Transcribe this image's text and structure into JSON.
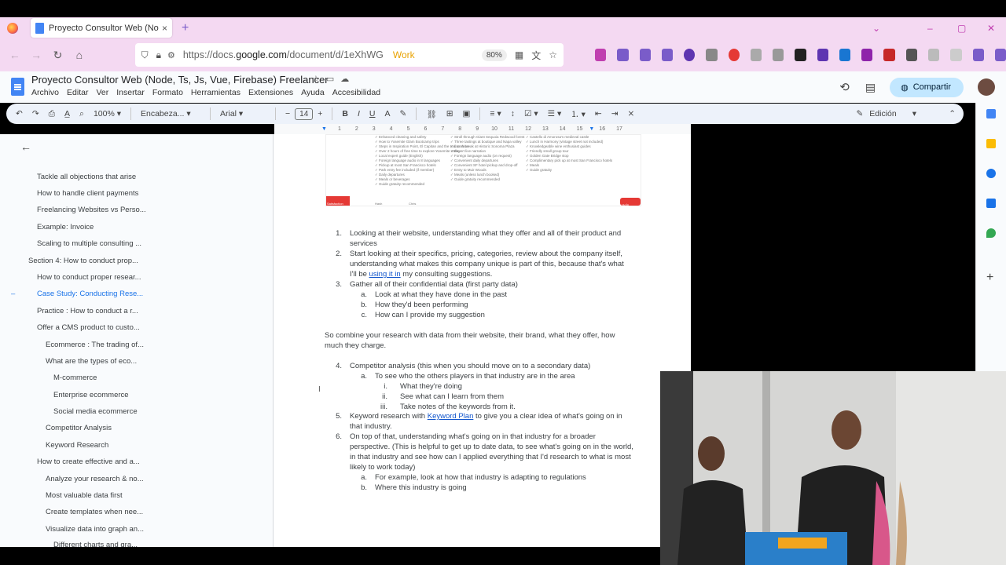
{
  "browser": {
    "tab_title": "Proyecto Consultor Web (Node...",
    "tab_close": "×",
    "new_tab": "+",
    "url_prefix": "https://docs.",
    "url_domain": "google.com",
    "url_path": "/document/d/1eXhWG",
    "work_tag": "Work",
    "zoom": "80%"
  },
  "doc": {
    "title": "Proyecto Consultor Web (Node, Ts, Js, Vue, Firebase) Freelancer",
    "menus": [
      "Archivo",
      "Editar",
      "Ver",
      "Insertar",
      "Formato",
      "Herramientas",
      "Extensiones",
      "Ayuda",
      "Accesibilidad"
    ],
    "share_label": "Compartir"
  },
  "toolbar": {
    "zoom": "100%",
    "style": "Encabeza...",
    "font": "Arial",
    "font_size": "14",
    "mode": "Edición"
  },
  "ruler": [
    "1",
    "2",
    "3",
    "4",
    "5",
    "6",
    "7",
    "8",
    "9",
    "10",
    "11",
    "12",
    "13",
    "14",
    "15",
    "16",
    "17"
  ],
  "outline": [
    "Tackle all objections that arise",
    "How to handle client payments",
    "Freelancing Websites vs Perso...",
    "Example: Invoice",
    "Scaling to multiple consulting ...",
    "Section 4: How to conduct prop...",
    "How to conduct proper resear...",
    "Case Study: Conducting Rese...",
    "Practice : How to conduct a r...",
    "Offer a CMS product to custo...",
    "Ecommerce : The trading of...",
    "What are the types of eco...",
    "M-commerce",
    "Enterprise ecommerce",
    "Social media ecommerce",
    "Competitor Analysis",
    "Keyword Research",
    "How to create effective and a...",
    "Analyze your research & no...",
    "Most valuable data first",
    "Create templates when nee...",
    "Visualize data into graph an...",
    "Different charts and gra..."
  ],
  "content": {
    "l1a": "Looking at their website, understanding what they offer and all of their product and",
    "l1b": "services",
    "l2a": "Start looking at their specifics, pricing, categories, review about the company itself,",
    "l2b": "understanding what makes this company unique is part of this, because that's what",
    "l2c_pre": "I'll be ",
    "l2c_link": "using it in",
    "l2c_post": " my consulting suggestions.",
    "l3": "Gather all of their confidential data (first party data)",
    "l3a": "Look at what they have done in the past",
    "l3b": "How they'd been performing",
    "l3c": "How can I provide my suggestion",
    "p1a": "So combine your research with data from their website, their brand, what they offer, how",
    "p1b": "much they charge.",
    "l4": "Competitor analysis (this when you should move on to a secondary data)",
    "l4a": "To see who the others players in that industry are in the area",
    "l4a1": "What they're doing",
    "l4a2": "See what can I learn from them",
    "l4a3": "Take notes of the keywords from it.",
    "l5_pre": "Keyword research with ",
    "l5_link": "Keyword Plan",
    "l5_post": " to give you a clear idea of what's going on in",
    "l5b": "that industry.",
    "l6a": "On top of that, understanding what's going on in that industry for a broader",
    "l6b": "perspective. (This is helpful to get up to date data, to see what's going on in the world,",
    "l6c": "in that industry and see how can I applied everything that I'd research to what is most",
    "l6d": "likely to work today)",
    "l6x": "For example, look at how that industry is adapting to regulations",
    "l6y": "Where this industry is going"
  },
  "markers": {
    "n1": "1.",
    "n2": "2.",
    "n3": "3.",
    "n4": "4.",
    "n5": "5.",
    "n6": "6.",
    "a": "a.",
    "b": "b.",
    "c": "c.",
    "i": "i.",
    "ii": "ii.",
    "iii": "iii."
  },
  "embedded_image": {
    "col1": "✓ Enhanced cleaning and safety\n✓ How to Yosemite Glam Bootcamp trips\n✓ Steps in Inspiration Point, El Capitan and the trail to Yosemite Falls\n✓ Over 2 hours of free time to explore Yosemite Valley\n✓ Local expert guide (English)\n✓ Foreign language audio in 8 languages\n✓ Pickup at most San Francisco hotels\n✓ Park entry fee included (if member)\n✓ Daily departures\n✓ Meals or beverages\n✓ Guide gratuity recommended",
    "col2": "✓ Stroll through Giant Sequoia Redwood forest\n✓ Three tastings at boutique and Napa valley\n✓ Lunch break at Historic Sonoma Plaza\n✓ Expert live narration\n✓ Foreign language audio (on request)\n✓ Convenient daily departures\n✓ Convenient SF hotel pickup and drop-off\n✓ Entry to Muir Woods\n✓ Meals (unless lunch booked)\n✓ Guide gratuity recommended",
    "col3": "✓ Castello di Amorosa's medieval castle\n✓ Lunch in Harmony (vintage street not included)\n✓ Knowledgeable wine enthusiast guides\n✓ Friendly small group tour\n✓ Golden Gate Bridge stop\n✓ Complimentary pick up at most San Francisco hotels\n✓ Meals\n✓ Guide gratuity",
    "badge_left": "Satisfaction Guaranteed",
    "foot_left": "Hash",
    "foot_mid": "Chris",
    "help": "Help"
  }
}
